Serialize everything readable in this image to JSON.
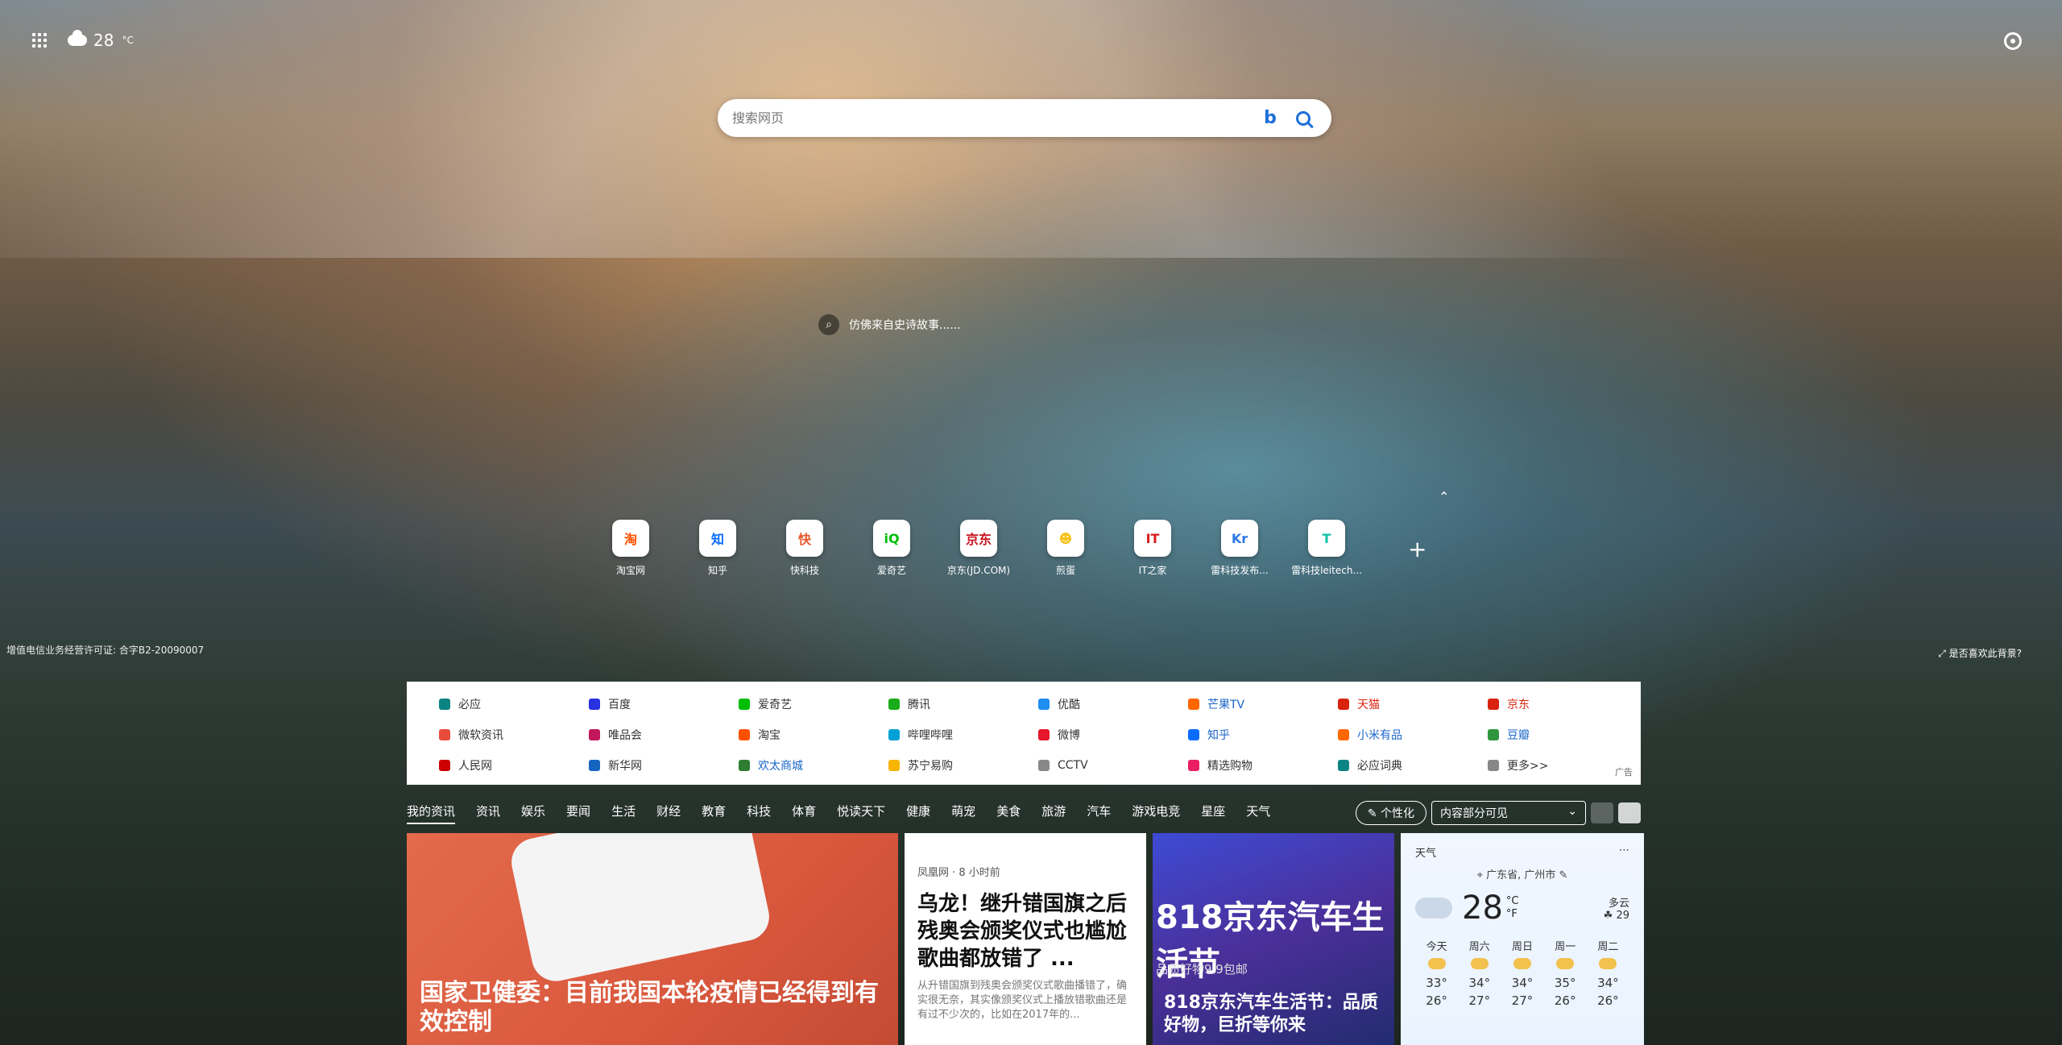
{
  "header": {
    "weather_temp": "28",
    "weather_unit": "°C",
    "settings_icon": "gear-icon",
    "apps_icon": "apps-grid-icon"
  },
  "search": {
    "placeholder": "搜索网页"
  },
  "poem": {
    "text": "仿佛来自史诗故事......"
  },
  "tiles": [
    {
      "label": "淘宝网",
      "glyph": "淘",
      "color": "#ff5000"
    },
    {
      "label": "知乎",
      "glyph": "知",
      "color": "#0a6cff"
    },
    {
      "label": "快科技",
      "glyph": "快",
      "color": "#e8582b"
    },
    {
      "label": "爱奇艺",
      "glyph": "iQ",
      "color": "#00be06"
    },
    {
      "label": "京东(JD.COM)",
      "glyph": "京东",
      "color": "#c91623"
    },
    {
      "label": "煎蛋",
      "glyph": "☻",
      "color": "#f6c21a"
    },
    {
      "label": "IT之家",
      "glyph": "IT",
      "color": "#d71c1c"
    },
    {
      "label": "雷科技发布...",
      "glyph": "Kr",
      "color": "#2f7be6"
    },
    {
      "label": "雷科技leitech...",
      "glyph": "T",
      "color": "#12c0a6"
    }
  ],
  "license": "增值电信业务经营许可证: 合字B2-20090007",
  "like_background": "是否喜欢此背景?",
  "links": [
    {
      "label": "必应",
      "color": "#0c8484",
      "style": ""
    },
    {
      "label": "百度",
      "color": "#2932e1",
      "style": ""
    },
    {
      "label": "爱奇艺",
      "color": "#00be06",
      "style": ""
    },
    {
      "label": "腾讯",
      "color": "#1aad19",
      "style": ""
    },
    {
      "label": "优酷",
      "color": "#1f8ef1",
      "style": ""
    },
    {
      "label": "芒果TV",
      "color": "#ff6600",
      "style": "hl"
    },
    {
      "label": "天猫",
      "color": "#d9230f",
      "style": "red"
    },
    {
      "label": "京东",
      "color": "#d9230f",
      "style": "red"
    },
    {
      "label": "微软资讯",
      "color": "#e74c3c",
      "style": ""
    },
    {
      "label": "唯品会",
      "color": "#c2185b",
      "style": ""
    },
    {
      "label": "淘宝",
      "color": "#ff5000",
      "style": ""
    },
    {
      "label": "哔哩哔哩",
      "color": "#00a1d6",
      "style": ""
    },
    {
      "label": "微博",
      "color": "#e6162d",
      "style": ""
    },
    {
      "label": "知乎",
      "color": "#0a6cff",
      "style": "hl"
    },
    {
      "label": "小米有品",
      "color": "#ff6700",
      "style": "hl"
    },
    {
      "label": "豆瓣",
      "color": "#2e963d",
      "style": "hl"
    },
    {
      "label": "人民网",
      "color": "#c00",
      "style": ""
    },
    {
      "label": "新华网",
      "color": "#1565c0",
      "style": ""
    },
    {
      "label": "欢太商城",
      "color": "#2e7d32",
      "style": "hl"
    },
    {
      "label": "苏宁易购",
      "color": "#f8b500",
      "style": ""
    },
    {
      "label": "CCTV",
      "color": "#888888",
      "style": ""
    },
    {
      "label": "精选购物",
      "color": "#e91e63",
      "style": ""
    },
    {
      "label": "必应词典",
      "color": "#0c8484",
      "style": ""
    },
    {
      "label": "更多>>",
      "color": "#888888",
      "style": ""
    }
  ],
  "ad_label": "广告",
  "tabs": [
    "我的资讯",
    "资讯",
    "娱乐",
    "要闻",
    "生活",
    "财经",
    "教育",
    "科技",
    "体育",
    "悦读天下",
    "健康",
    "萌宠",
    "美食",
    "旅游",
    "汽车",
    "游戏电竞",
    "星座",
    "天气"
  ],
  "personalize": "个性化",
  "visibility_select": "内容部分可见",
  "cards": {
    "c1_title": "国家卫健委：目前我国本轮疫情已经得到有效控制",
    "c2_source": "凤凰网 · 8 小时前",
    "c2_title": "乌龙！继升错国旗之后残奥会颁奖仪式也尴尬 歌曲都放错了 ...",
    "c2_summary": "从升错国旗到残奥会颁奖仪式歌曲播错了，确实很无奈，其实像颁奖仪式上播放错歌曲还是有过不少次的，比如在2017年的...",
    "c3_big": "818京东汽车生活节",
    "c3_sub": "品质好物9.9包邮",
    "c3_title": "818京东汽车生活节：品质好物，巨折等你来"
  },
  "weather_card": {
    "title": "天气",
    "location": "广东省, 广州市",
    "temp": "28",
    "unit_c": "°C",
    "unit_f": "°F",
    "desc": "多云",
    "aqi": "29",
    "forecast": [
      {
        "day": "今天",
        "hi": "33°",
        "lo": "26°"
      },
      {
        "day": "周六",
        "hi": "34°",
        "lo": "27°"
      },
      {
        "day": "周日",
        "hi": "34°",
        "lo": "27°"
      },
      {
        "day": "周一",
        "hi": "35°",
        "lo": "26°"
      },
      {
        "day": "周二",
        "hi": "34°",
        "lo": "26°"
      }
    ]
  }
}
